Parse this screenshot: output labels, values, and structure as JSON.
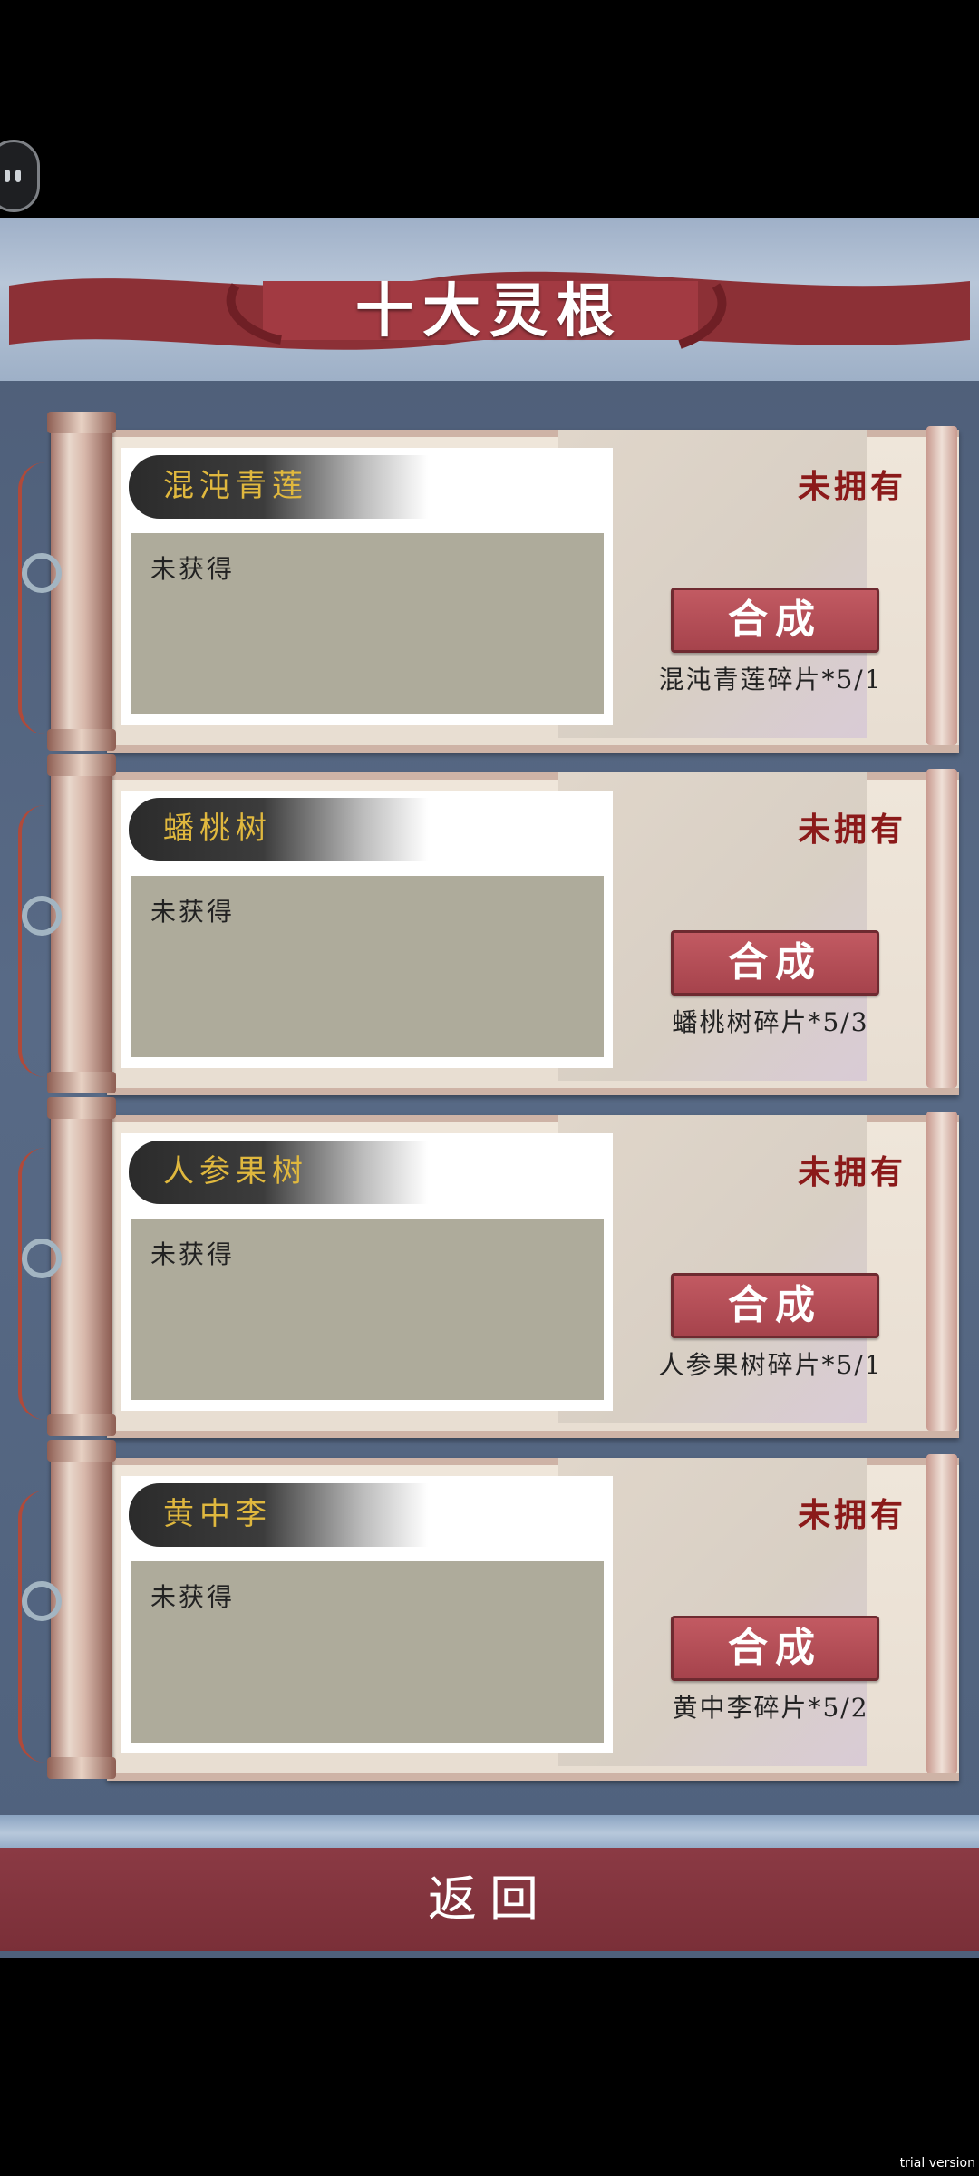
{
  "title": "十大灵根",
  "cards": [
    {
      "name": "混沌青莲",
      "info": "未获得",
      "status": "未拥有",
      "button": "合成",
      "fragment": "混沌青莲碎片*5/1"
    },
    {
      "name": "蟠桃树",
      "info": "未获得",
      "status": "未拥有",
      "button": "合成",
      "fragment": "蟠桃树碎片*5/3"
    },
    {
      "name": "人参果树",
      "info": "未获得",
      "status": "未拥有",
      "button": "合成",
      "fragment": "人参果树碎片*5/1"
    },
    {
      "name": "黄中李",
      "info": "未获得",
      "status": "未拥有",
      "button": "合成",
      "fragment": "黄中李碎片*5/2"
    }
  ],
  "back_button": "返回",
  "watermark": "trial version",
  "colors": {
    "status_red": "#8b1a1a",
    "name_gold": "#e0b83e",
    "button_red": "#a6434c",
    "info_box": "#aeab9b"
  }
}
